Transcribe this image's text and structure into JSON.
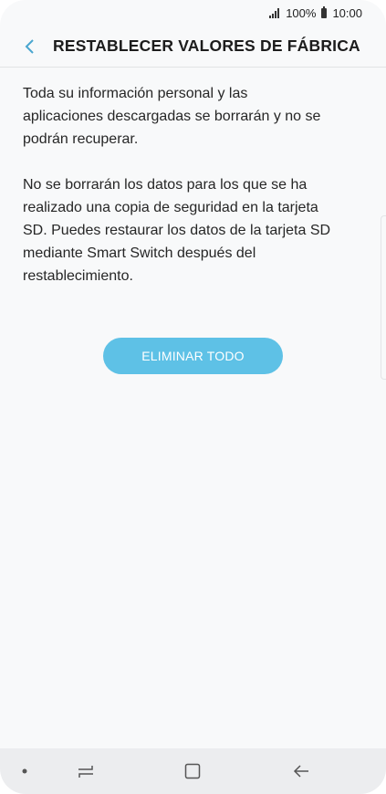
{
  "status_bar": {
    "battery": "100%",
    "time": "10:00"
  },
  "header": {
    "title": "RESTABLECER VALORES DE FÁBRICA",
    "back_icon": "chevron-left-icon",
    "accent_color": "#4aa6cf"
  },
  "content": {
    "paragraph_1": "Toda su información personal y las aplicaciones descargadas se borrarán y no se podrán recuperar.",
    "paragraph_2": "No se borrarán los datos para los que se ha realizado una copia de seguridad en la tarjeta SD. Puedes restaurar los datos de la tarjeta SD mediante Smart Switch después del restablecimiento."
  },
  "actions": {
    "delete_all_label": "ELIMINAR TODO",
    "button_color": "#5ec1e6"
  },
  "nav_bar": {
    "items": [
      "dot-icon",
      "recents-icon",
      "home-icon",
      "back-arrow-icon"
    ]
  }
}
